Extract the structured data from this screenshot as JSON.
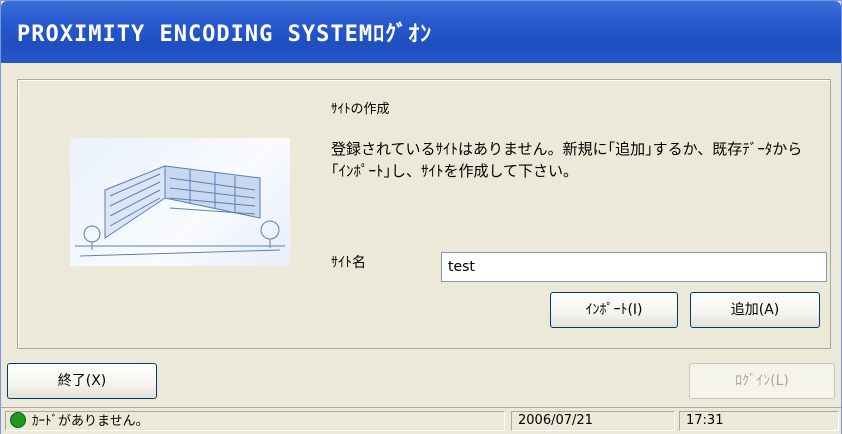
{
  "window": {
    "title": "PROXIMITY ENCODING SYSTEMﾛｸﾞｵﾝ"
  },
  "panel": {
    "section_title": "ｻｲﾄの作成",
    "message": "登録されているｻｲﾄはありません。新規に｢追加｣するか、既存ﾃﾞｰﾀから｢ｲﾝﾎﾟｰﾄ｣し、ｻｲﾄを作成して下さい。",
    "site_label": "ｻｲﾄ名",
    "site_value": "test",
    "import_label": "ｲﾝﾎﾟｰﾄ(I)",
    "add_label": "追加(A)"
  },
  "footer": {
    "exit_label": "終了(X)",
    "login_label": "ﾛｸﾞｲﾝ(L)"
  },
  "statusbar": {
    "message": "ｶｰﾄﾞがありません。",
    "date": "2006/07/21",
    "time": "17:31",
    "status_color": "#1f9a1f"
  },
  "icons": {
    "status": "status-light-icon",
    "illustration": "building-illustration"
  }
}
